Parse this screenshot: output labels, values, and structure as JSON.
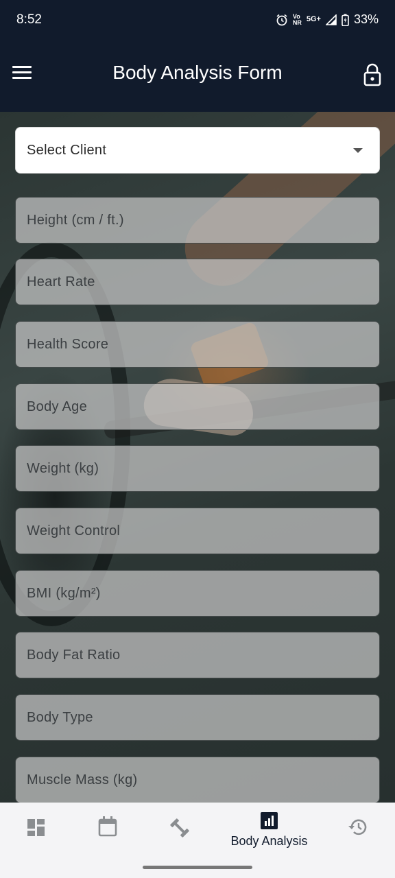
{
  "status_bar": {
    "time": "8:52",
    "volte_top": "Vo",
    "volte_bottom": "NR",
    "network": "5G+",
    "battery": "33%"
  },
  "app_bar": {
    "title": "Body Analysis Form"
  },
  "form": {
    "select_client": "Select Client",
    "fields": [
      "Height (cm / ft.)",
      "Heart Rate",
      "Health Score",
      "Body Age",
      "Weight (kg)",
      "Weight Control",
      "BMI (kg/m²)",
      "Body Fat Ratio",
      "Body Type",
      "Muscle Mass (kg)"
    ]
  },
  "bottom_nav": {
    "items": [
      {
        "icon": "dashboard-icon",
        "label": ""
      },
      {
        "icon": "calendar-icon",
        "label": ""
      },
      {
        "icon": "dumbbell-icon",
        "label": ""
      },
      {
        "icon": "body-analysis-icon",
        "label": "Body Analysis",
        "active": true
      },
      {
        "icon": "history-icon",
        "label": ""
      }
    ]
  },
  "colors": {
    "primary": "#111b2c",
    "field_bg": "#c8c8c8",
    "nav_bg": "#f4f4f6"
  }
}
